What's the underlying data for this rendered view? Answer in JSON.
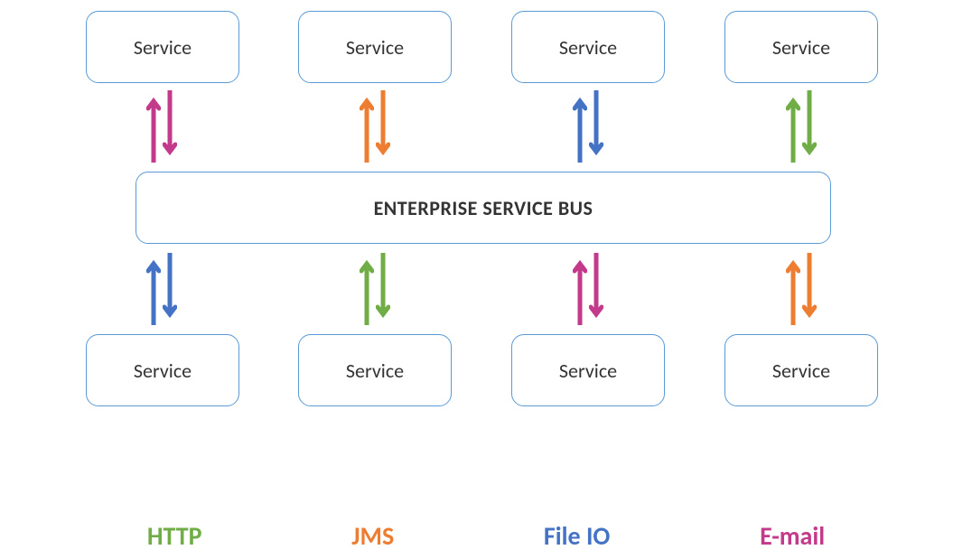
{
  "services_top": [
    {
      "label": "Service"
    },
    {
      "label": "Service"
    },
    {
      "label": "Service"
    },
    {
      "label": "Service"
    }
  ],
  "services_bottom": [
    {
      "label": "Service"
    },
    {
      "label": "Service"
    },
    {
      "label": "Service"
    },
    {
      "label": "Service"
    }
  ],
  "bus": {
    "label": "ENTERPRISE SERVICE BUS"
  },
  "arrows_top": [
    {
      "up_color": "#c43a8a",
      "down_color": "#c43a8a"
    },
    {
      "up_color": "#ed7d31",
      "down_color": "#ed7d31"
    },
    {
      "up_color": "#4472c4",
      "down_color": "#4472c4"
    },
    {
      "up_color": "#70ad47",
      "down_color": "#70ad47"
    }
  ],
  "arrows_bottom": [
    {
      "up_color": "#4472c4",
      "down_color": "#4472c4"
    },
    {
      "up_color": "#70ad47",
      "down_color": "#70ad47"
    },
    {
      "up_color": "#c43a8a",
      "down_color": "#c43a8a"
    },
    {
      "up_color": "#ed7d31",
      "down_color": "#ed7d31"
    }
  ],
  "legend": [
    {
      "label": "HTTP",
      "color_class": "c-green"
    },
    {
      "label": "JMS",
      "color_class": "c-orange"
    },
    {
      "label": "File IO",
      "color_class": "c-blue"
    },
    {
      "label": "E-mail",
      "color_class": "c-pink"
    }
  ],
  "colors": {
    "http": "#70ad47",
    "jms": "#ed7d31",
    "fileio": "#4472c4",
    "email": "#c43a8a",
    "box_border": "#5b9bd5"
  }
}
